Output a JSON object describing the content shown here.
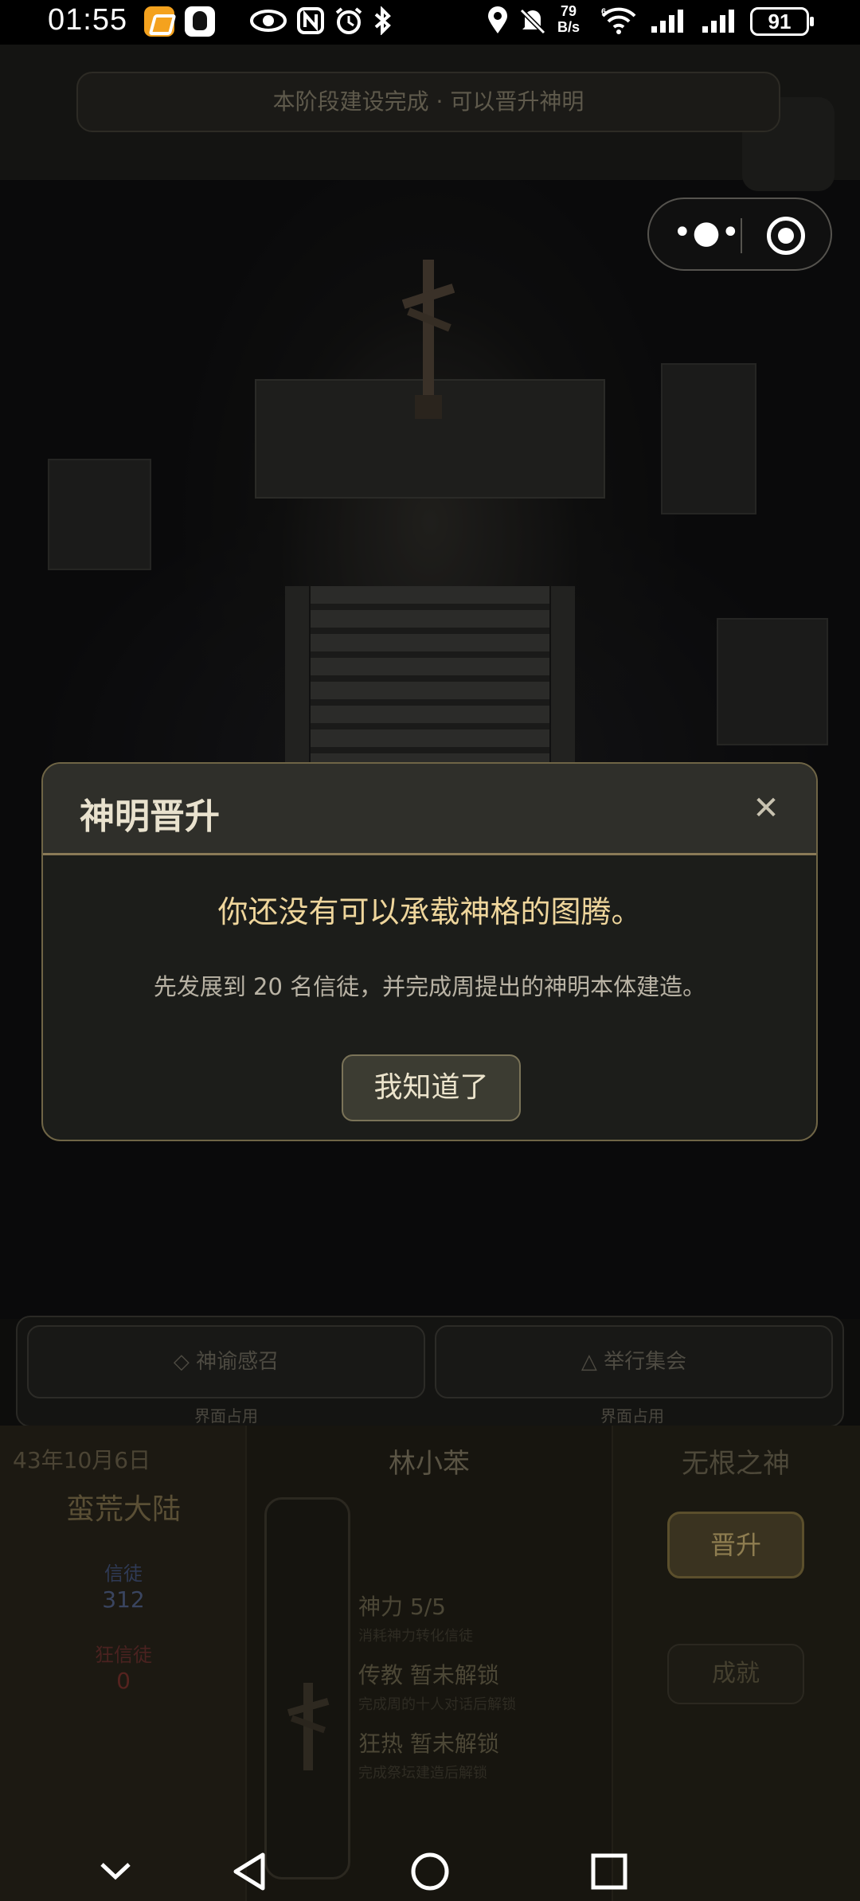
{
  "status_bar": {
    "time": "01:55",
    "net_speed_value": "79",
    "net_speed_unit": "B/s",
    "wifi_label": "6",
    "battery": "91"
  },
  "top_notice": "本阶段建设完成 · 可以晋升神明",
  "dialog": {
    "title": "神明晋升",
    "message": "你还没有可以承载神格的图腾。",
    "description": "先发展到 20 名信徒，并完成周提出的神明本体建造。",
    "confirm_label": "我知道了",
    "close_icon": "close-icon"
  },
  "actions": [
    {
      "label": "◇ 神谕感召",
      "caption": "界面占用"
    },
    {
      "label": "△ 举行集会",
      "caption": "界面占用"
    }
  ],
  "left_panel": {
    "date": "43年10月6日",
    "world": "蛮荒大陆",
    "followers_label": "信徒",
    "followers_value": "312",
    "zealots_label": "狂信徒",
    "zealots_value": "0"
  },
  "center_panel": {
    "name": "林小苯",
    "power": "神力 5/5",
    "power_desc": "消耗神力转化信徒",
    "preach": "传教 暂未解锁",
    "preach_desc": "完成周的十人对话后解锁",
    "fervor": "狂热 暂未解锁",
    "fervor_desc": "完成祭坛建造后解锁"
  },
  "right_panel": {
    "title": "无根之神",
    "promote_label": "晋升",
    "achievement_label": "成就"
  },
  "colors": {
    "dialog_accent": "#efd69c",
    "border_gold": "#8a7a57"
  }
}
